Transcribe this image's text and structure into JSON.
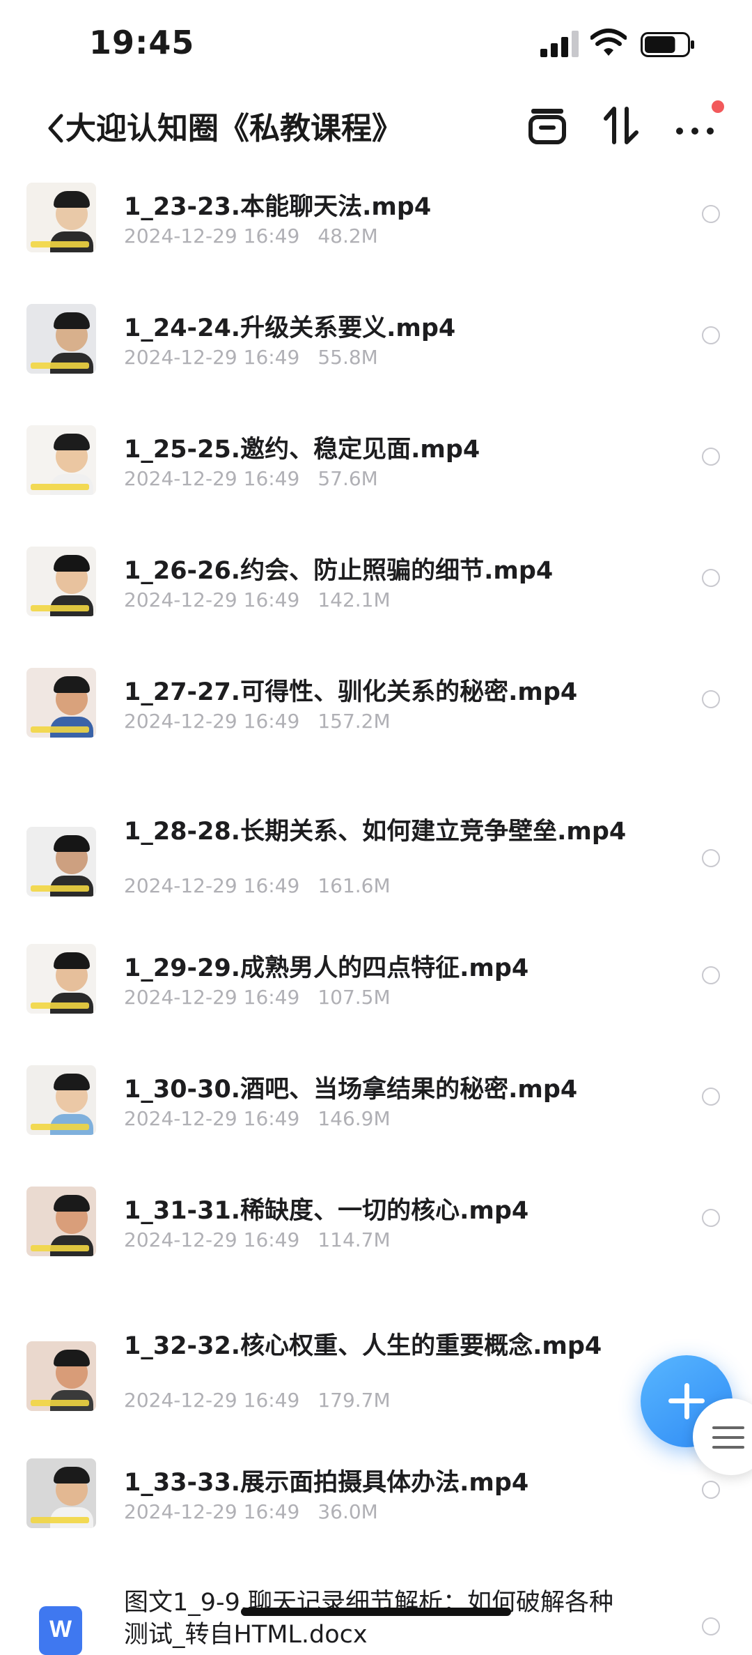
{
  "status_bar": {
    "time": "19:45",
    "battery_percent": 75
  },
  "header": {
    "back_icon": "chevron-left-icon",
    "title": "大迎认知圈《私教课程》",
    "actions": [
      "select-all-icon",
      "sort-icon",
      "more-icon"
    ],
    "notification_color": "#f2595b"
  },
  "files": [
    {
      "name": "1_23-23.本能聊天法.mp4",
      "date": "2024-12-29 16:49",
      "size": "48.2M"
    },
    {
      "name": "1_24-24.升级关系要义.mp4",
      "date": "2024-12-29 16:49",
      "size": "55.8M"
    },
    {
      "name": "1_25-25.邀约、稳定见面.mp4",
      "date": "2024-12-29 16:49",
      "size": "57.6M"
    },
    {
      "name": "1_26-26.约会、防止照骗的细节.mp4",
      "date": "2024-12-29 16:49",
      "size": "142.1M"
    },
    {
      "name": "1_27-27.可得性、驯化关系的秘密.mp4",
      "date": "2024-12-29 16:49",
      "size": "157.2M"
    },
    {
      "name": "1_28-28.长期关系、如何建立竞争壁垒.mp4",
      "date": "2024-12-29 16:49",
      "size": "161.6M"
    },
    {
      "name": "1_29-29.成熟男人的四点特征.mp4",
      "date": "2024-12-29 16:49",
      "size": "107.5M"
    },
    {
      "name": "1_30-30.酒吧、当场拿结果的秘密.mp4",
      "date": "2024-12-29 16:49",
      "size": "146.9M"
    },
    {
      "name": "1_31-31.稀缺度、一切的核心.mp4",
      "date": "2024-12-29 16:49",
      "size": "114.7M"
    },
    {
      "name": "1_32-32.核心权重、人生的重要概念.mp4",
      "date": "2024-12-29 16:49",
      "size": "179.7M"
    },
    {
      "name": "1_33-33.展示面拍摄具体办法.mp4",
      "date": "2024-12-29 16:49",
      "size": "36.0M"
    }
  ],
  "last_file": {
    "name_line1": "图文1_9-9.聊天记录细节解析：如何破解各种",
    "name_line2": "测试_转自HTML.docx",
    "icon_letter": "W"
  },
  "fab_icon": "plus-icon",
  "side_handle_icon": "menu-lines-icon",
  "accent_color": "#3a94f8"
}
